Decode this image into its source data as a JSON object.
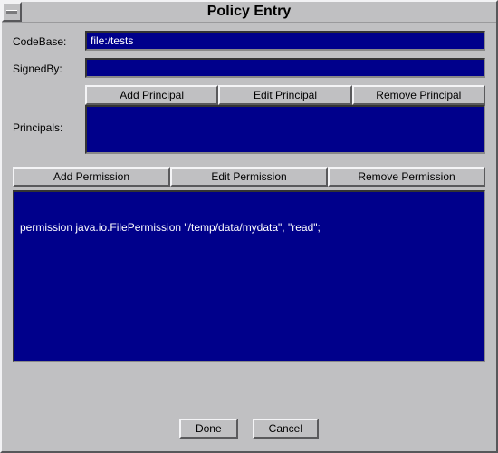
{
  "title": "Policy Entry",
  "labels": {
    "codebase": "CodeBase:",
    "signedby": "SignedBy:",
    "principals": "Principals:"
  },
  "inputs": {
    "codebase_value": "file:/tests",
    "signedby_value": ""
  },
  "buttons": {
    "add_principal": "Add Principal",
    "edit_principal": "Edit Principal",
    "remove_principal": "Remove Principal",
    "add_permission": "Add Permission",
    "edit_permission": "Edit Permission",
    "remove_permission": "Remove Permission",
    "done": "Done",
    "cancel": "Cancel"
  },
  "principals_list": [],
  "permissions_list": [
    "permission java.io.FilePermission \"/temp/data/mydata\", \"read\";"
  ]
}
